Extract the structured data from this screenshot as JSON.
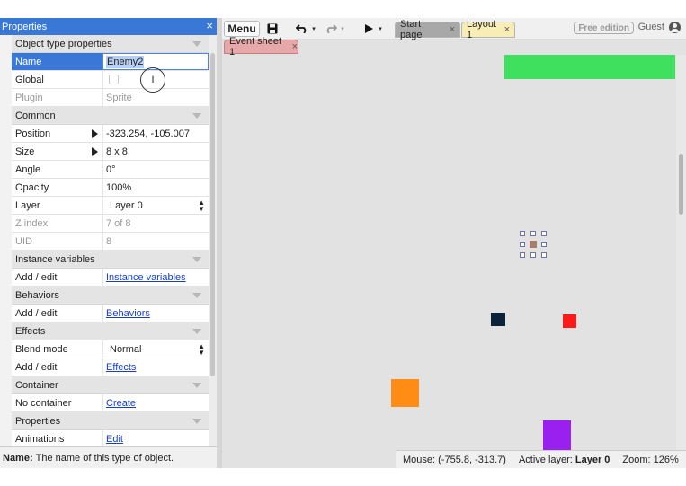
{
  "properties_panel": {
    "title": "Properties",
    "close_glyph": "×",
    "rows": [
      {
        "type": "section",
        "label": "Object type properties"
      },
      {
        "type": "field",
        "key": "Name",
        "value": "Enemy2",
        "selected": true
      },
      {
        "type": "field",
        "key": "Global",
        "value": "",
        "checkbox": true
      },
      {
        "type": "field",
        "key": "Plugin",
        "value": "Sprite",
        "dim": true
      },
      {
        "type": "section",
        "label": "Common"
      },
      {
        "type": "field",
        "key": "Position",
        "value": "-323.254, -105.007",
        "expand": true
      },
      {
        "type": "field",
        "key": "Size",
        "value": "8 x 8",
        "expand": true
      },
      {
        "type": "field",
        "key": "Angle",
        "value": "0°"
      },
      {
        "type": "field",
        "key": "Opacity",
        "value": "100%"
      },
      {
        "type": "field",
        "key": "Layer",
        "value": "Layer 0",
        "dropdown": true
      },
      {
        "type": "field",
        "key": "Z index",
        "value": "7 of 8",
        "dim": true
      },
      {
        "type": "field",
        "key": "UID",
        "value": "8",
        "dim": true
      },
      {
        "type": "section",
        "label": "Instance variables"
      },
      {
        "type": "field",
        "key": "Add / edit",
        "value": "Instance variables",
        "link": true
      },
      {
        "type": "section",
        "label": "Behaviors"
      },
      {
        "type": "field",
        "key": "Add / edit",
        "value": "Behaviors",
        "link": true
      },
      {
        "type": "section",
        "label": "Effects"
      },
      {
        "type": "field",
        "key": "Blend mode",
        "value": "Normal",
        "dropdown": true
      },
      {
        "type": "field",
        "key": "Add / edit",
        "value": "Effects",
        "link": true
      },
      {
        "type": "section",
        "label": "Container"
      },
      {
        "type": "field",
        "key": "No container",
        "value": "Create",
        "link": true
      },
      {
        "type": "section",
        "label": "Properties"
      },
      {
        "type": "field",
        "key": "Animations",
        "value": "Edit",
        "link": true
      }
    ]
  },
  "help_bar": {
    "label": "Name:",
    "text": "The name of this type of object."
  },
  "toolbar": {
    "menu_label": "Menu",
    "tabs": [
      {
        "label": "Start page",
        "close": "×"
      },
      {
        "label": "Layout 1",
        "close": "×"
      }
    ],
    "free_edition": "Free edition",
    "user": "Guest"
  },
  "subtabs": {
    "event_sheet": {
      "label": "Event sheet 1",
      "close": "×"
    }
  },
  "status_bar": {
    "mouse": "Mouse: (-755.8, -313.7)",
    "active_layer_label": "Active layer:",
    "active_layer_value": "Layer 0",
    "zoom": "Zoom: 126%"
  },
  "colors": {
    "accent": "#3a78d8",
    "green_object": "#3ee05e",
    "navy_object": "#0c2238",
    "red_object": "#ff1a1a",
    "orange_object": "#ff8c14",
    "purple_object": "#9a20f0",
    "layout_tab": "#f8edb5",
    "event_tab": "#e6a8a8"
  }
}
